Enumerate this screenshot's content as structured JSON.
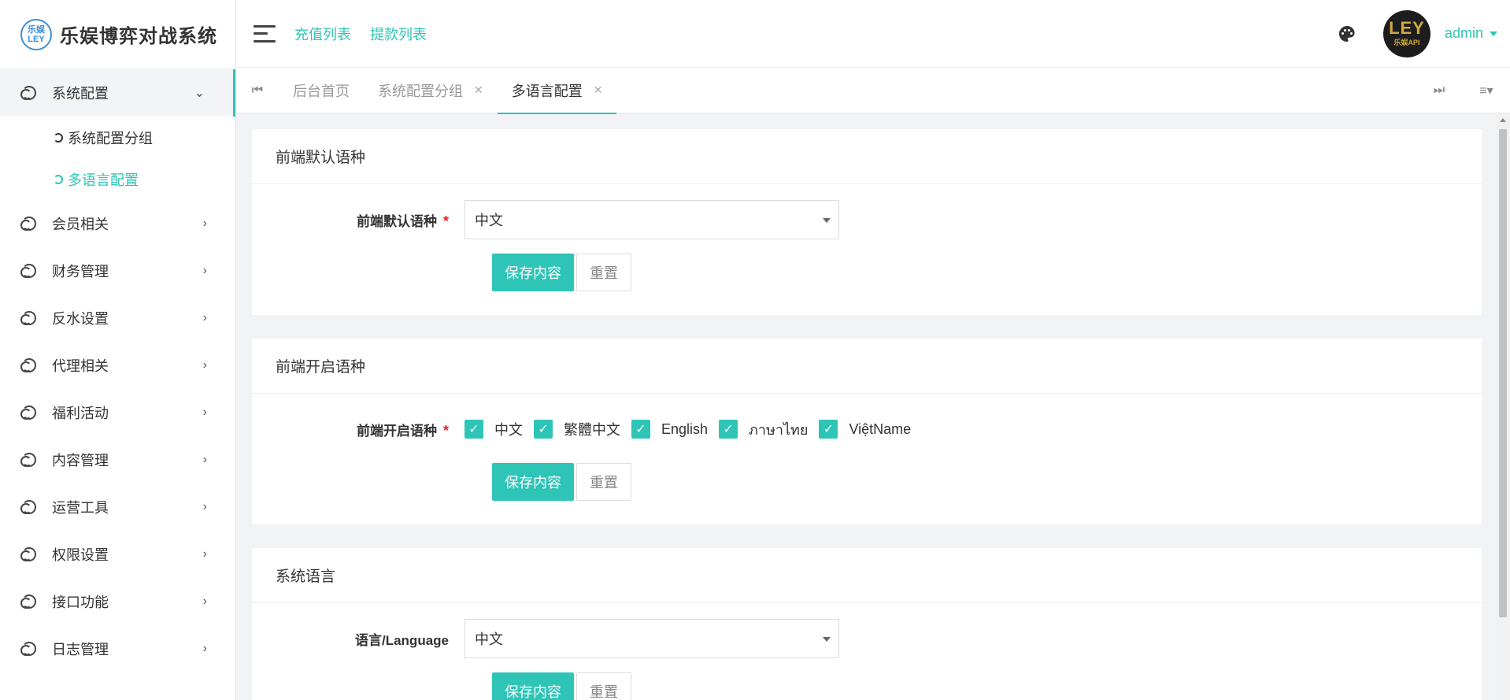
{
  "app": {
    "title": "乐娱博弈对战系统",
    "logo_top": "乐娱",
    "logo_bottom": "LEY",
    "accent_color": "#2ec4b6"
  },
  "sidebar": {
    "items": [
      {
        "label": "系统配置",
        "icon": "circle-icon",
        "expanded": true,
        "children": [
          {
            "label": "系统配置分组",
            "active": false
          },
          {
            "label": "多语言配置",
            "active": true
          }
        ]
      },
      {
        "label": "会员相关",
        "icon": "circle-icon"
      },
      {
        "label": "财务管理",
        "icon": "circle-icon"
      },
      {
        "label": "反水设置",
        "icon": "circle-icon"
      },
      {
        "label": "代理相关",
        "icon": "circle-icon"
      },
      {
        "label": "福利活动",
        "icon": "circle-icon"
      },
      {
        "label": "内容管理",
        "icon": "circle-icon"
      },
      {
        "label": "运营工具",
        "icon": "circle-icon"
      },
      {
        "label": "权限设置",
        "icon": "circle-icon"
      },
      {
        "label": "接口功能",
        "icon": "circle-icon"
      },
      {
        "label": "日志管理",
        "icon": "circle-icon"
      }
    ]
  },
  "header": {
    "links": [
      "充值列表",
      "提款列表"
    ],
    "avatar_text": "LEY",
    "avatar_sub": "乐娱API",
    "user": "admin"
  },
  "tabs": [
    {
      "label": "后台首页",
      "closable": false,
      "active": false
    },
    {
      "label": "系统配置分组",
      "closable": true,
      "active": false
    },
    {
      "label": "多语言配置",
      "closable": true,
      "active": true
    }
  ],
  "sections": {
    "default_lang": {
      "title": "前端默认语种",
      "label": "前端默认语种",
      "value": "中文",
      "save": "保存内容",
      "reset": "重置"
    },
    "enabled_lang": {
      "title": "前端开启语种",
      "label": "前端开启语种",
      "options": [
        "中文",
        "繁體中文",
        "English",
        "ภาษาไทย",
        "ViệtName"
      ],
      "checked": [
        true,
        true,
        true,
        true,
        true
      ],
      "save": "保存内容",
      "reset": "重置"
    },
    "system_lang": {
      "title": "系统语言",
      "label": "语言/Language",
      "value": "中文",
      "save": "保存内容",
      "reset": "重置"
    }
  }
}
